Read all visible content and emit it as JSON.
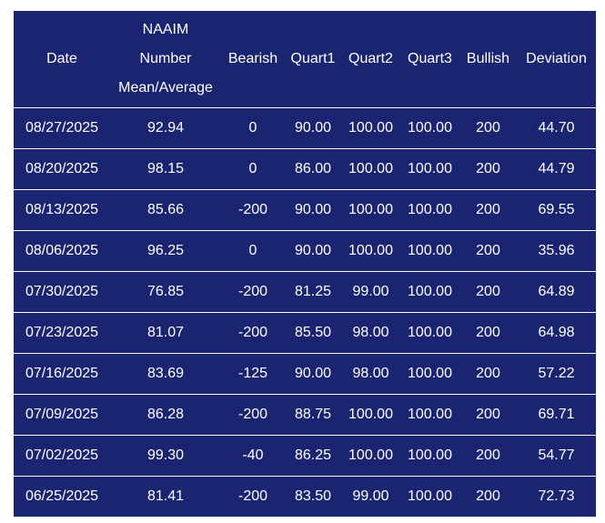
{
  "chart_data": {
    "type": "table",
    "columns": [
      "Date",
      "NAAIM Number Mean/Average",
      "Bearish",
      "Quart1",
      "Quart2",
      "Quart3",
      "Bullish",
      "Deviation"
    ],
    "header_lines": {
      "date": "Date",
      "mean_line1": "NAAIM",
      "mean_line2": "Number",
      "mean_line3": "Mean/Average",
      "bearish": "Bearish",
      "quart1": "Quart1",
      "quart2": "Quart2",
      "quart3": "Quart3",
      "bullish": "Bullish",
      "deviation": "Deviation"
    },
    "rows": [
      [
        "08/27/2025",
        "92.94",
        "0",
        "90.00",
        "100.00",
        "100.00",
        "200",
        "44.70"
      ],
      [
        "08/20/2025",
        "98.15",
        "0",
        "86.00",
        "100.00",
        "100.00",
        "200",
        "44.79"
      ],
      [
        "08/13/2025",
        "85.66",
        "-200",
        "90.00",
        "100.00",
        "100.00",
        "200",
        "69.55"
      ],
      [
        "08/06/2025",
        "96.25",
        "0",
        "90.00",
        "100.00",
        "100.00",
        "200",
        "35.96"
      ],
      [
        "07/30/2025",
        "76.85",
        "-200",
        "81.25",
        "99.00",
        "100.00",
        "200",
        "64.89"
      ],
      [
        "07/23/2025",
        "81.07",
        "-200",
        "85.50",
        "98.00",
        "100.00",
        "200",
        "64.98"
      ],
      [
        "07/16/2025",
        "83.69",
        "-125",
        "90.00",
        "98.00",
        "100.00",
        "200",
        "57.22"
      ],
      [
        "07/09/2025",
        "86.28",
        "-200",
        "88.75",
        "100.00",
        "100.00",
        "200",
        "69.71"
      ],
      [
        "07/02/2025",
        "99.30",
        "-40",
        "86.25",
        "100.00",
        "100.00",
        "200",
        "54.77"
      ],
      [
        "06/25/2025",
        "81.41",
        "-200",
        "83.50",
        "99.00",
        "100.00",
        "200",
        "72.73"
      ]
    ]
  },
  "colors": {
    "background": "#1b2470",
    "text": "#ffffff",
    "divider": "#ffffff"
  }
}
